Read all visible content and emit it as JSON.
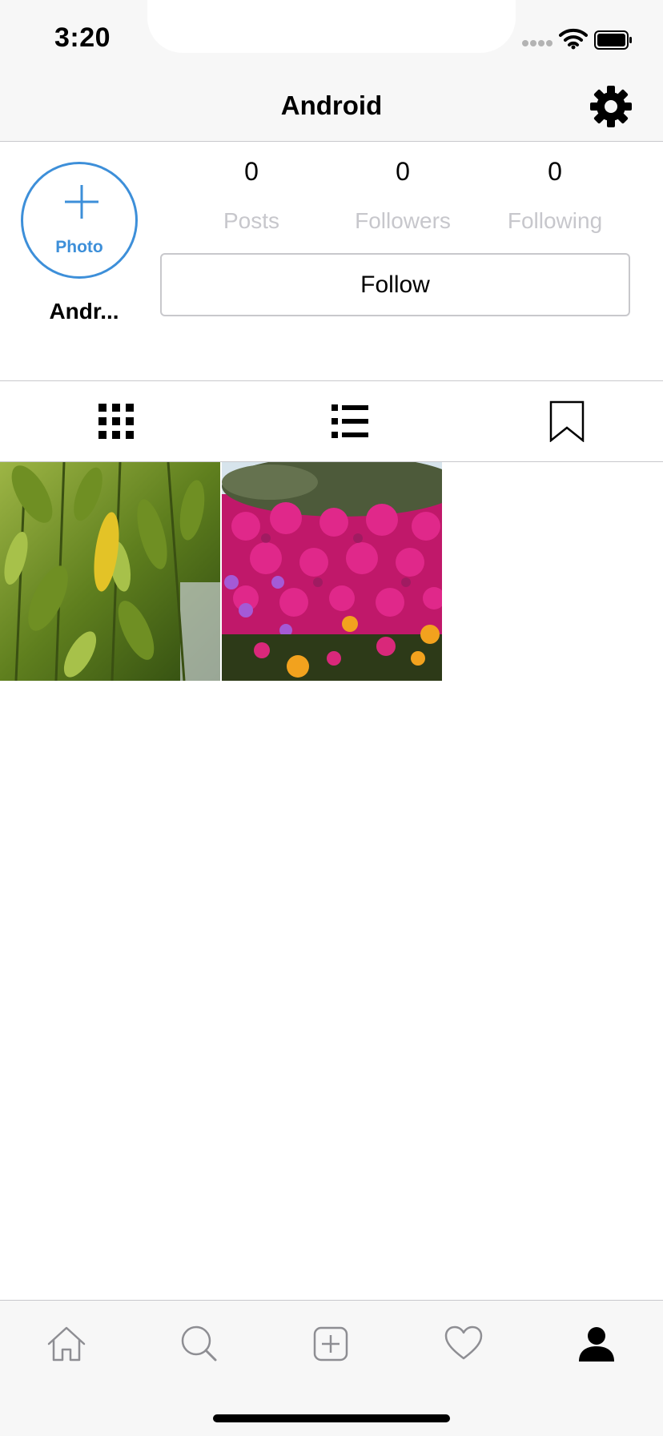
{
  "status_bar": {
    "time": "3:20"
  },
  "nav": {
    "title": "Android"
  },
  "profile": {
    "avatar_label": "Photo",
    "username": "Andr...",
    "stats": [
      {
        "value": "0",
        "label": "Posts"
      },
      {
        "value": "0",
        "label": "Followers"
      },
      {
        "value": "0",
        "label": "Following"
      }
    ],
    "follow_label": "Follow"
  },
  "tabs": [
    {
      "icon": "grid-icon"
    },
    {
      "icon": "list-icon"
    },
    {
      "icon": "bookmark-icon"
    }
  ],
  "photos": [
    {
      "subject": "leaves"
    },
    {
      "subject": "magenta-flowers"
    }
  ],
  "tabbar": [
    {
      "icon": "home-icon"
    },
    {
      "icon": "search-icon"
    },
    {
      "icon": "add-post-icon"
    },
    {
      "icon": "heart-icon"
    },
    {
      "icon": "profile-icon"
    }
  ],
  "colors": {
    "accent": "#3d8fd9",
    "muted_label": "#c7c7cc",
    "divider": "#c8c8cc",
    "bar_background": "#f7f7f7"
  }
}
